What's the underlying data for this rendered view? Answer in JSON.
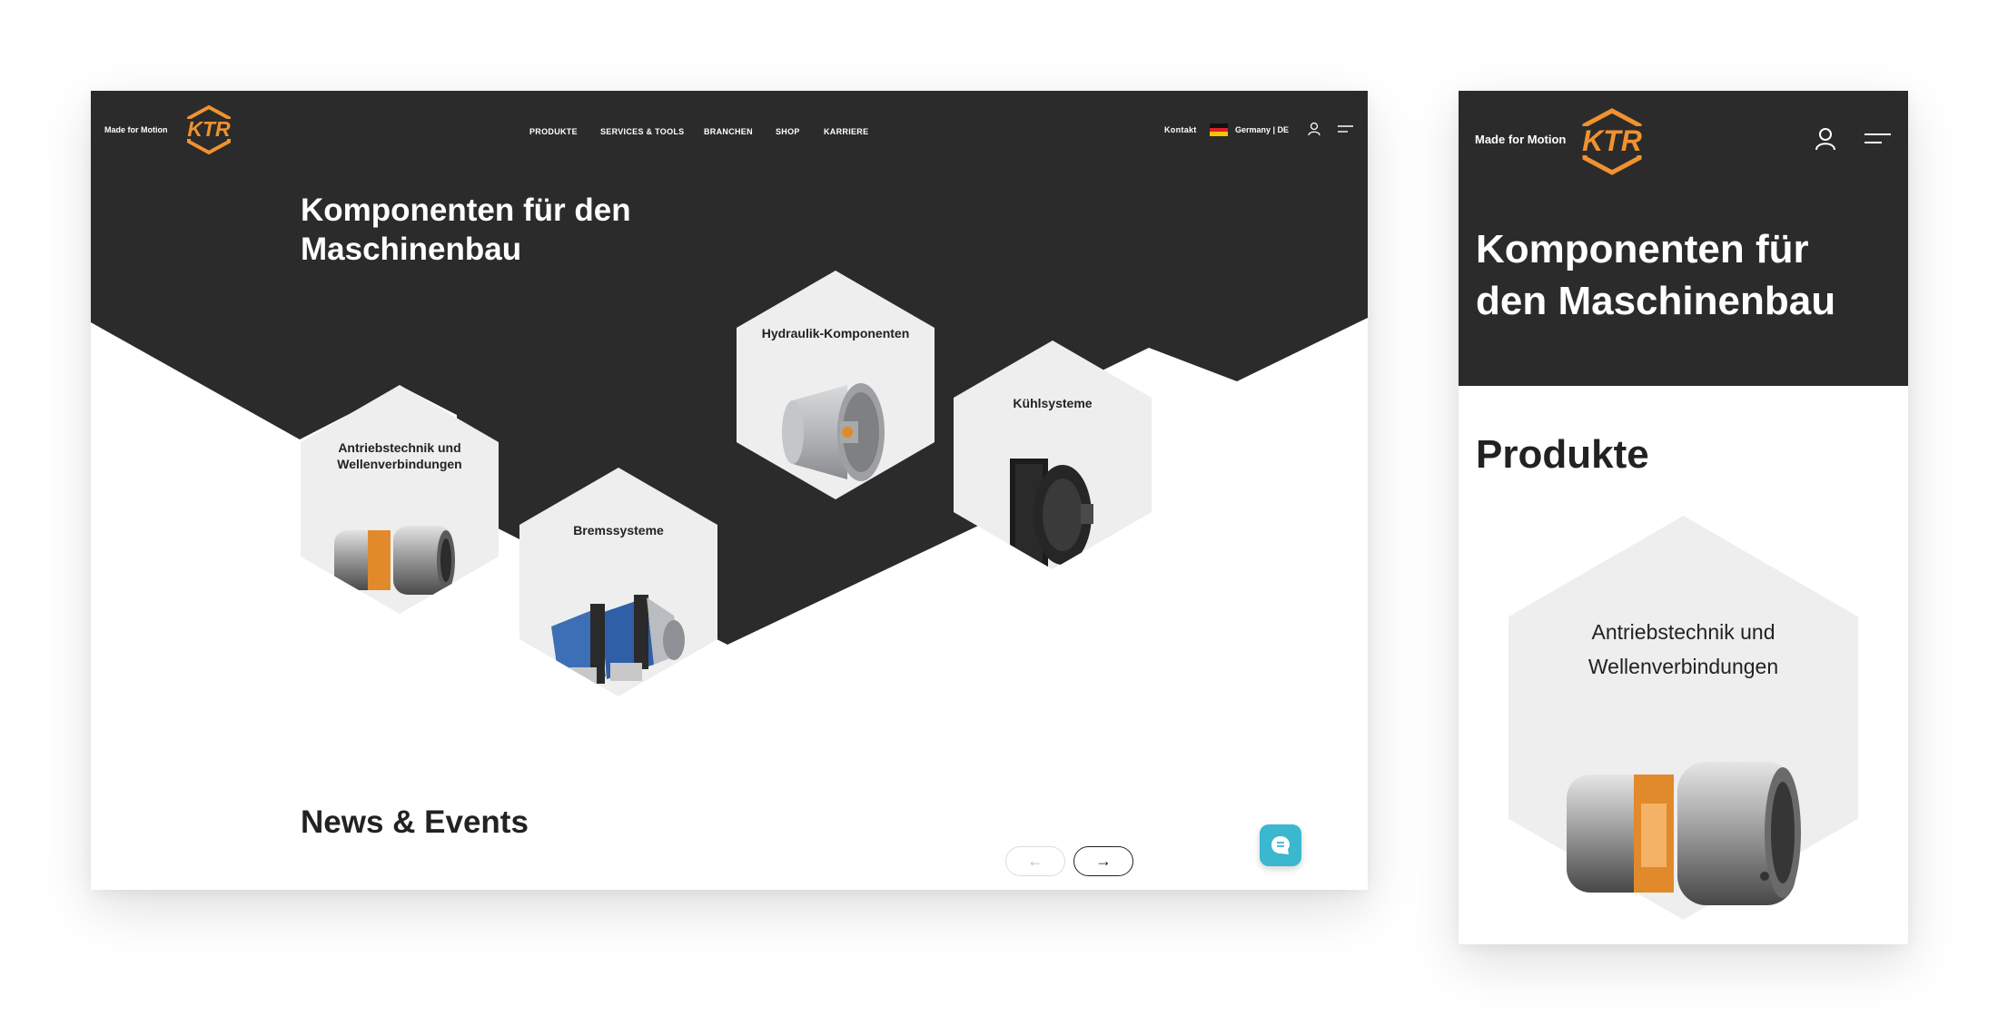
{
  "brand": {
    "tagline": "Made for Motion",
    "logo": "KTR",
    "accent": "#f0922f",
    "dark": "#2b2b2b"
  },
  "desktop": {
    "nav": [
      "PRODUKTE",
      "SERVICES & TOOLS",
      "BRANCHEN",
      "SHOP",
      "KARRIERE"
    ],
    "contact": "Kontakt",
    "region": "Germany | DE",
    "hero_title_line1": "Komponenten für den",
    "hero_title_line2": "Maschinenbau",
    "products": [
      {
        "label_line1": "Antriebstechnik und",
        "label_line2": "Wellenverbindungen",
        "icon": "coupling-icon"
      },
      {
        "label_line1": "Bremssysteme",
        "label_line2": "",
        "icon": "brake-icon"
      },
      {
        "label_line1": "Hydraulik-Komponenten",
        "label_line2": "",
        "icon": "hydraulic-icon"
      },
      {
        "label_line1": "Kühlsysteme",
        "label_line2": "",
        "icon": "cooler-icon"
      }
    ],
    "news_title": "News & Events",
    "prev_arrow": "←",
    "next_arrow": "→",
    "chat_icon": "chat-icon"
  },
  "mobile": {
    "hero_title_line1": "Komponenten für",
    "hero_title_line2": "den Maschinenbau",
    "section_title": "Produkte",
    "product_label_line1": "Antriebstechnik und",
    "product_label_line2": "Wellenverbindungen"
  }
}
